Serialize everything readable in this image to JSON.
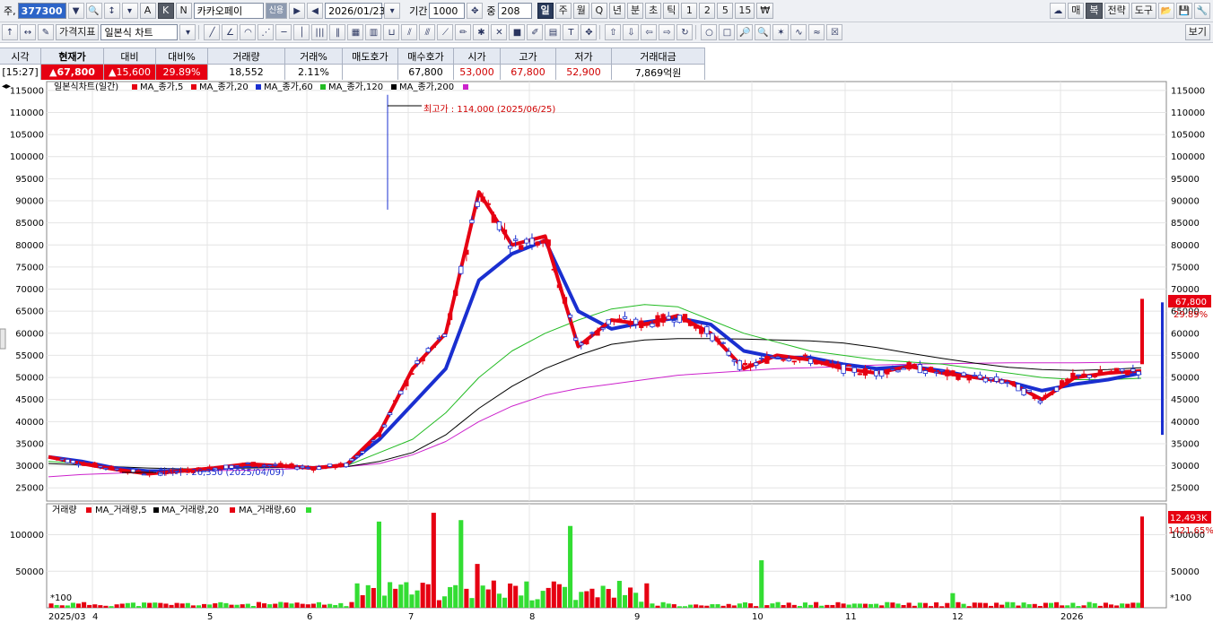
{
  "toolbar": {
    "prefix": "주,",
    "stock_code": "377300",
    "mode_a": "A",
    "mode_k": "K",
    "mode_n": "N",
    "stock_name": "카카오페이",
    "name_badge": "신용",
    "date": "2026/01/23",
    "period_label": "기간",
    "period_value": "1000",
    "amount_label": "중",
    "amount_value": "208",
    "timeframes": [
      "일",
      "주",
      "월",
      "Q",
      "년",
      "분",
      "초",
      "틱",
      "1",
      "2",
      "5",
      "15",
      "₩"
    ],
    "timeframe_selected": "일",
    "right_buttons": [
      "매",
      "복",
      "전략",
      "도구"
    ],
    "indicator_btn": "가격지표",
    "chart_type": "일본식 차트",
    "view_btn": "보기"
  },
  "info": {
    "headers": [
      "시각",
      "현재가",
      "대비",
      "대비%",
      "거래량",
      "거래%",
      "매도호가",
      "매수호가",
      "시가",
      "고가",
      "저가",
      "거래대금"
    ],
    "values": [
      "[15:27]",
      "▲67,800",
      "▲15,600",
      "29.89%",
      "18,552",
      "2.11%",
      "",
      "67,800",
      "53,000",
      "67,800",
      "52,900",
      "7,869억원"
    ]
  },
  "legend": {
    "price": [
      "일본식차트(일간)",
      "MA_종가,5",
      "MA_종가,20",
      "MA_종가,60",
      "MA_종가,120",
      "MA_종가,200"
    ],
    "volume": [
      "거래량",
      "MA_거래량,5",
      "MA_거래량,20",
      "MA_거래량,60"
    ]
  },
  "annotations": {
    "high": "최고가 : 114,000 (2025/06/25)",
    "low": "최저가 : 26,350 (2025/04/09)",
    "current_price": "67,800",
    "current_pct": "29.89%",
    "volume_value": "12,493K",
    "volume_pct": "1421.65%",
    "volume_unit": "*100"
  },
  "colors": {
    "up": "#e60012",
    "down": "#1a2fd0",
    "ma5": "#e60012",
    "ma20": "#1a2fd0",
    "ma60": "#22bb22",
    "ma120": "#000000",
    "ma200": "#cc22cc",
    "vol_up": "#e60012",
    "vol_down": "#33dd33"
  },
  "chart_data": {
    "type": "candlestick",
    "price_axis": {
      "ylim": [
        22000,
        117000
      ],
      "ticks": [
        25000,
        30000,
        35000,
        40000,
        45000,
        50000,
        55000,
        60000,
        65000,
        70000,
        75000,
        80000,
        85000,
        90000,
        95000,
        100000,
        105000,
        110000,
        115000
      ]
    },
    "volume_axis": {
      "ylim": [
        0,
        135000
      ],
      "ticks": [
        50000,
        100000
      ]
    },
    "x_labels": [
      "2025/03",
      "4",
      "5",
      "6",
      "7",
      "8",
      "9",
      "10",
      "11",
      "12",
      "2026"
    ],
    "series": [
      {
        "name": "MA_종가,5",
        "values": [
          32000,
          30500,
          29200,
          28200,
          28800,
          29500,
          30400,
          30000,
          29500,
          30200,
          37500,
          52000,
          60000,
          92000,
          80000,
          82000,
          57000,
          63000,
          62000,
          64000,
          60000,
          52000,
          55000,
          54000,
          52000,
          51000,
          52500,
          51000,
          50000,
          49000,
          45000,
          50000,
          51000,
          51500
        ]
      },
      {
        "name": "MA_종가,20",
        "values": [
          32000,
          31000,
          29500,
          28800,
          28800,
          29300,
          30000,
          30000,
          29500,
          30200,
          36000,
          44000,
          52000,
          72000,
          78000,
          81000,
          65000,
          61000,
          62500,
          63500,
          62000,
          56000,
          54500,
          54500,
          53000,
          52000,
          52500,
          51500,
          50000,
          49000,
          47000,
          48500,
          49500,
          51000
        ]
      },
      {
        "name": "MA_종가,60",
        "values": [
          31000,
          30500,
          29500,
          29000,
          29000,
          29300,
          29800,
          29800,
          29800,
          30000,
          33000,
          36000,
          42000,
          50000,
          56000,
          60000,
          63000,
          65500,
          66500,
          66000,
          63000,
          60000,
          58000,
          56000,
          55000,
          54000,
          53500,
          53000,
          52000,
          51000,
          50000,
          49500,
          49500,
          49800
        ]
      },
      {
        "name": "MA_종가,120",
        "values": [
          30500,
          30200,
          29800,
          29500,
          29300,
          29300,
          29500,
          29600,
          29700,
          29800,
          31000,
          33000,
          37000,
          43000,
          48000,
          52000,
          55000,
          57500,
          58500,
          58800,
          58800,
          58700,
          58500,
          58300,
          57800,
          56800,
          55500,
          54300,
          53200,
          52300,
          51800,
          51600,
          51800,
          52200
        ]
      },
      {
        "name": "MA_종가,200",
        "values": [
          27500,
          28000,
          28300,
          28600,
          28800,
          28900,
          29000,
          29200,
          29500,
          29800,
          30500,
          32500,
          35500,
          40000,
          43500,
          46000,
          47500,
          48500,
          49500,
          50500,
          51000,
          51500,
          52000,
          52200,
          52500,
          52800,
          53000,
          53100,
          53200,
          53300,
          53300,
          53300,
          53400,
          53500
        ]
      }
    ],
    "current": 67800,
    "high": 114000,
    "low": 26350,
    "volume_last": 124930
  }
}
